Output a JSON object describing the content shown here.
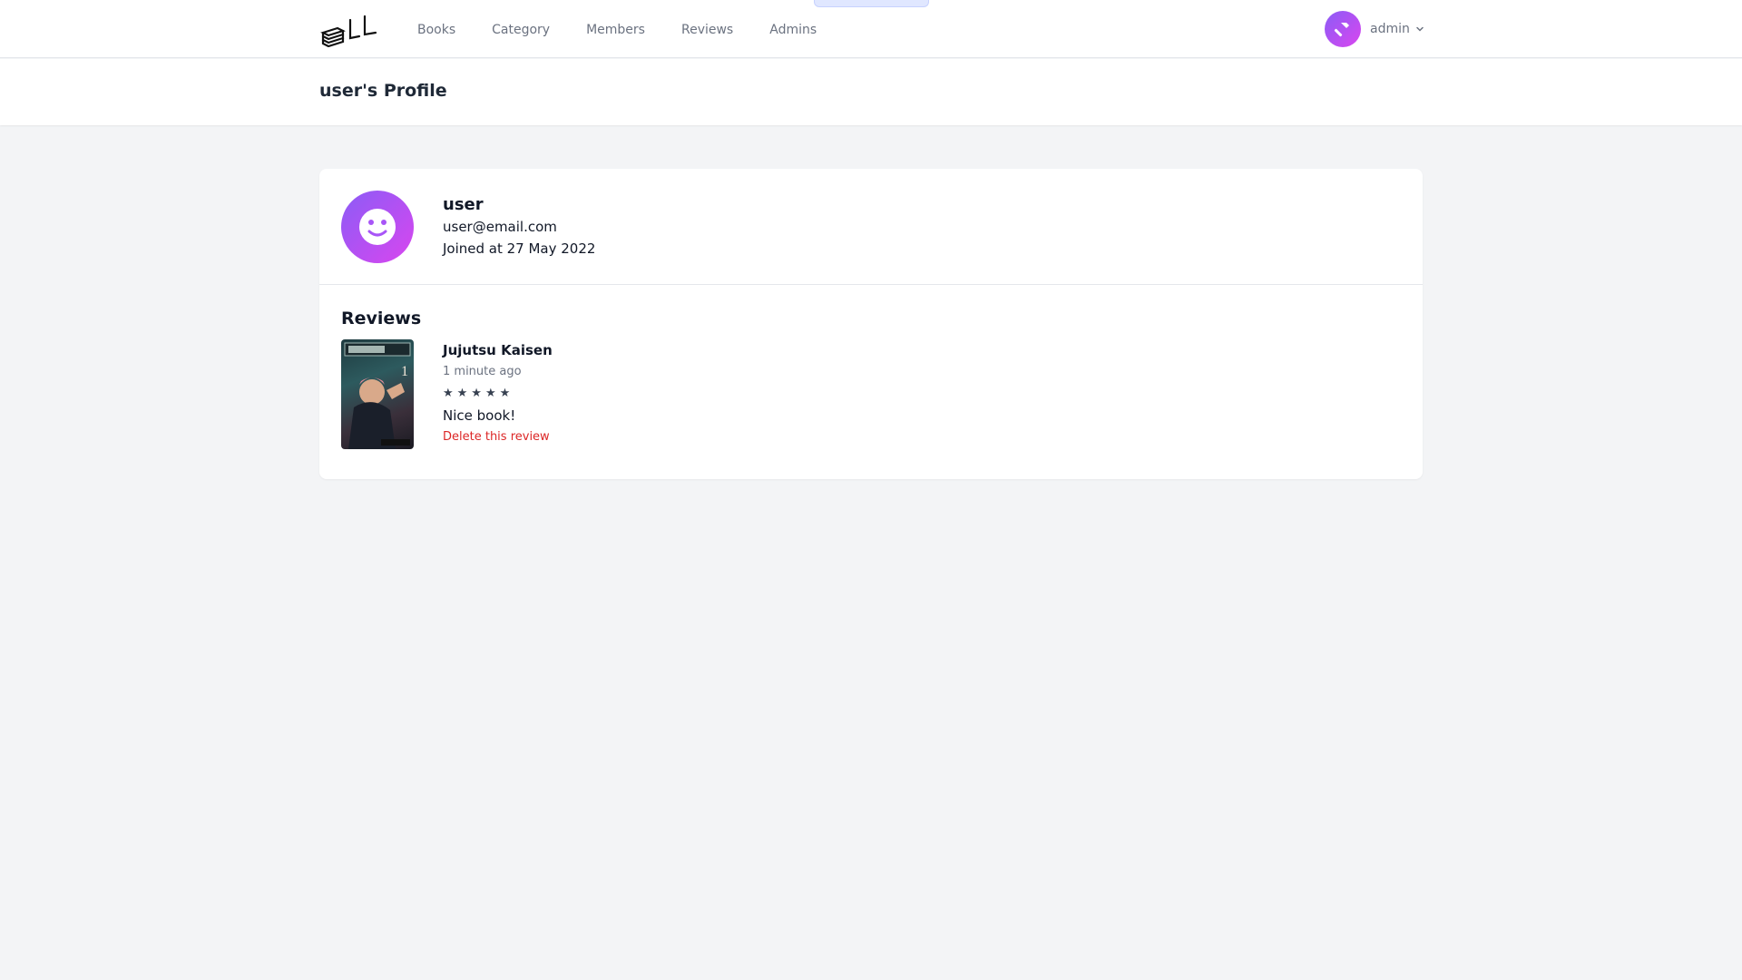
{
  "nav": {
    "logo_icon": "book-stack-logo",
    "links": [
      {
        "label": "Books"
      },
      {
        "label": "Category"
      },
      {
        "label": "Members"
      },
      {
        "label": "Reviews"
      },
      {
        "label": "Admins"
      }
    ],
    "user": {
      "name": "admin",
      "avatar_icon": "hammer-icon"
    }
  },
  "header": {
    "title": "user's Profile"
  },
  "profile": {
    "avatar_icon": "smiley-face-icon",
    "name": "user",
    "email": "user@email.com",
    "joined": "Joined at 27 May 2022"
  },
  "reviews": {
    "heading": "Reviews",
    "items": [
      {
        "book_title": "Jujutsu Kaisen",
        "time": "1 minute ago",
        "stars": "★★★★★",
        "rating": 5,
        "text": "Nice book!",
        "delete_label": "Delete this review"
      }
    ]
  },
  "colors": {
    "accent_gradient_start": "#8b5cf6",
    "accent_gradient_end": "#d946ef",
    "delete": "#dc2626",
    "background": "#f3f4f6"
  }
}
